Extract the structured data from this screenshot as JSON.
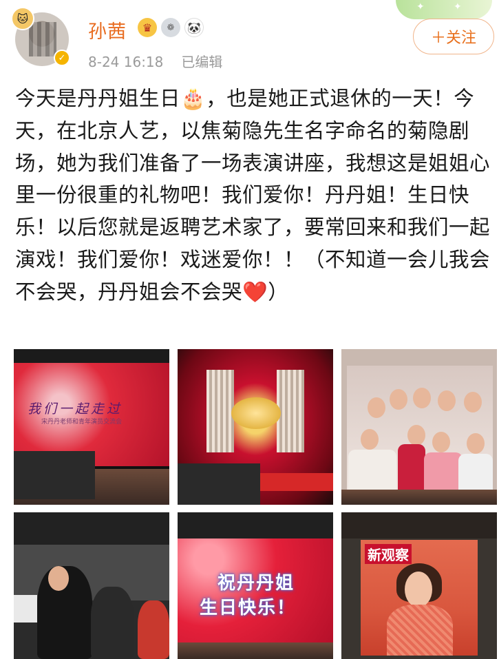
{
  "user": {
    "name": "孙茜",
    "meta_time": "8-24 16:18",
    "meta_edited": "已编辑"
  },
  "badges": [
    "crown-badge",
    "medal-badge",
    "panda-badge"
  ],
  "follow_button": "＋关注",
  "post": {
    "text_part1": "今天是丹丹姐生日",
    "emoji_cake": "🎂",
    "text_part2": "，也是她正式退休的一天！今天，在北京人艺，以焦菊隐先生名字命名的菊隐剧场，她为我们准备了一场表演讲座，我想这是姐姐心里一份很重的礼物吧！我们爱你！丹丹姐！生日快乐！以后您就是返聘艺术家了，要常回来和我们一起演戏！我们爱你！戏迷爱你！！（不知道一会儿我会不会哭，丹丹姐会不会哭",
    "emoji_heart": "❤️",
    "text_part3": "）"
  },
  "photos": {
    "p1_screen_title": "我们一起走过",
    "p1_screen_sub": "宋丹丹老师和青年演员交流会",
    "p5_line1": "祝丹丹姐",
    "p5_line2": "生日快乐！",
    "p6_magazine": "新观察"
  },
  "colors": {
    "username": "#e86b1f",
    "follow_border": "#f0b48a",
    "meta": "#9a9a9a"
  }
}
